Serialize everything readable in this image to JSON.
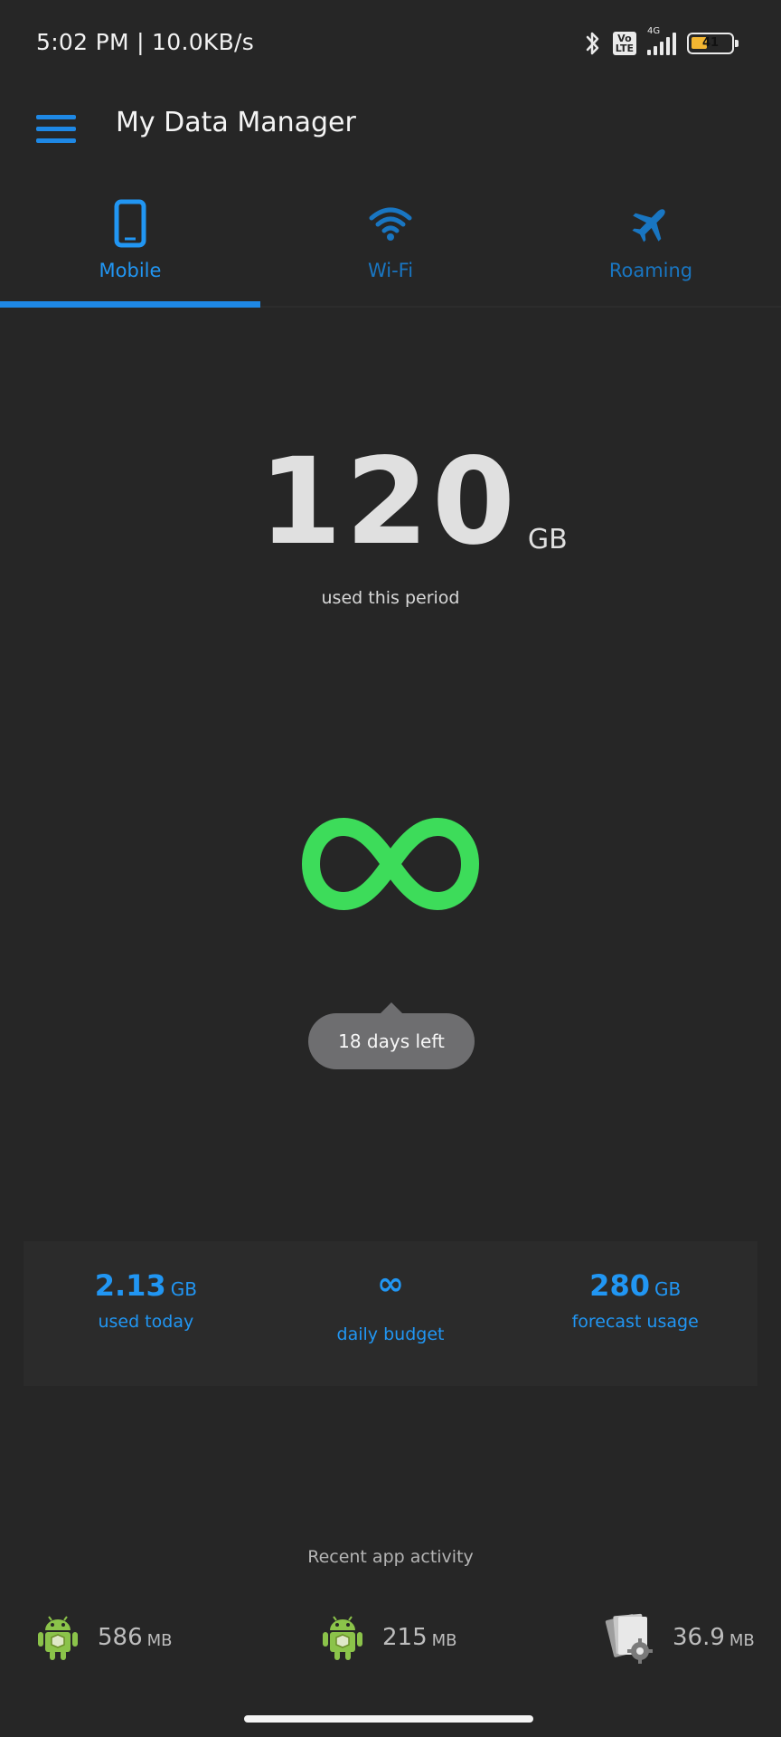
{
  "status_bar": {
    "time_speed": "5:02 PM | 10.0KB/s",
    "volte_label": "Vo LTE",
    "network_label": "4G",
    "battery_level": "41",
    "battery_fraction": 0.41
  },
  "app_bar": {
    "title": "My Data Manager"
  },
  "tabs": [
    {
      "label": "Mobile",
      "icon": "smartphone-icon",
      "active": true
    },
    {
      "label": "Wi-Fi",
      "icon": "wifi-icon",
      "active": false
    },
    {
      "label": "Roaming",
      "icon": "airplane-icon",
      "active": false
    }
  ],
  "usage": {
    "amount": "120",
    "unit": "GB",
    "caption": "used this period"
  },
  "plan": {
    "limit_icon": "infinity-icon",
    "days_left": "18 days left"
  },
  "stats": {
    "used_today": {
      "value": "2.13",
      "unit": "GB",
      "label": "used today"
    },
    "daily_budget": {
      "value": "∞",
      "label": "daily budget"
    },
    "forecast": {
      "value": "280",
      "unit": "GB",
      "label": "forecast usage"
    }
  },
  "recent": {
    "title": "Recent app activity",
    "items": [
      {
        "icon": "android-app-icon",
        "value": "586",
        "unit": "MB"
      },
      {
        "icon": "android-app-icon",
        "value": "215",
        "unit": "MB"
      },
      {
        "icon": "system-settings-app-icon",
        "value": "36.9",
        "unit": "MB"
      }
    ]
  },
  "colors": {
    "background": "#262626",
    "accent": "#2196f3",
    "infinity_green": "#3ddc5a"
  }
}
